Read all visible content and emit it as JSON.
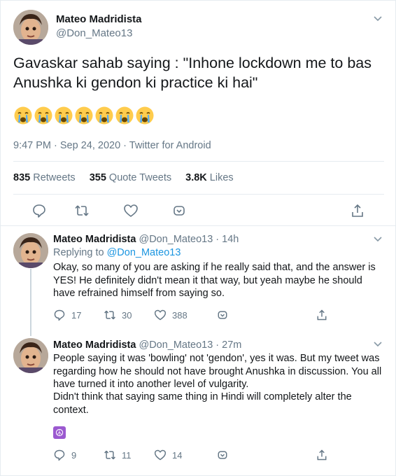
{
  "tweet": {
    "author_name": "Mateo Madridista",
    "author_handle": "@Don_Mateo13",
    "text": "Gavaskar sahab saying : \"Inhone lockdown me to bas Anushka ki gendon ki practice ki hai\"",
    "emoji_count": 7,
    "emoji": "crying-face",
    "meta": "9:47 PM · Sep 24, 2020 · Twitter for Android",
    "retweets_count": "835",
    "retweets_label": "Retweets",
    "quote_count": "355",
    "quote_label": "Quote Tweets",
    "likes_count": "3.8K",
    "likes_label": "Likes"
  },
  "replies": [
    {
      "author_name": "Mateo Madridista",
      "handle_time": "@Don_Mateo13 · 14h",
      "replying_prefix": "Replying to ",
      "replying_to": "@Don_Mateo13",
      "text": "Okay, so many of you are asking if he really said that, and the answer is YES! He definitely didn't mean it that way, but yeah maybe he should have refrained himself from saying so.",
      "reply_count": "17",
      "retweet_count": "30",
      "like_count": "388"
    },
    {
      "author_name": "Mateo Madridista",
      "handle_time": "@Don_Mateo13 · 27m",
      "text_line1": "People saying it was 'bowling' not 'gendon', yes it was. But my tweet was regarding how he should not have brought Anushka in discussion. You all have turned it into another level of vulgarity.",
      "text_line2": "Didn't think that saying same thing in Hindi will completely alter the context.",
      "extra_emoji": "☮",
      "reply_count": "9",
      "retweet_count": "11",
      "like_count": "14"
    }
  ],
  "colors": {
    "text": "#14171a",
    "secondary": "#657786",
    "link": "#1b95e0",
    "border": "#e6ecf0"
  }
}
